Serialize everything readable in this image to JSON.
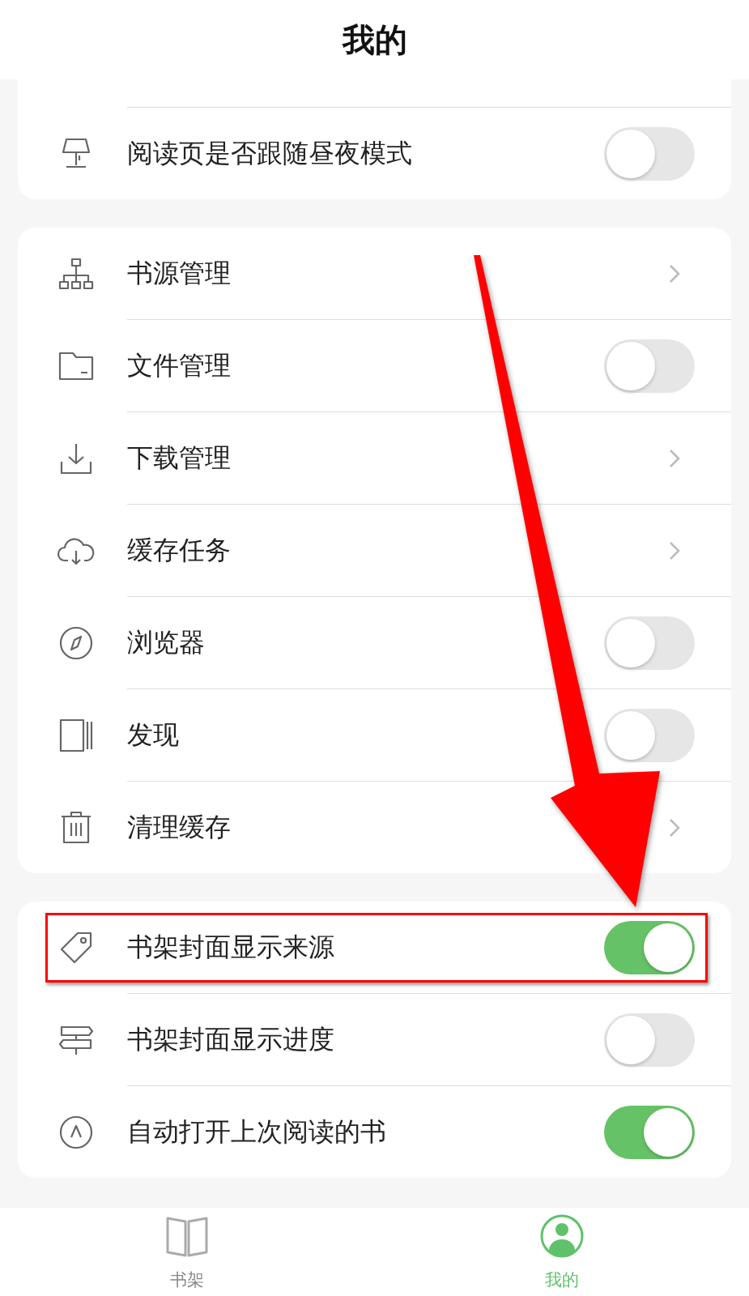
{
  "header": {
    "title": "我的"
  },
  "sections": [
    {
      "rows": [
        {
          "label": "阅读页是否跟随昼夜模式",
          "kind": "toggle",
          "on": false
        }
      ]
    },
    {
      "rows": [
        {
          "label": "书源管理",
          "kind": "link"
        },
        {
          "label": "文件管理",
          "kind": "toggle",
          "on": false
        },
        {
          "label": "下载管理",
          "kind": "link"
        },
        {
          "label": "缓存任务",
          "kind": "link"
        },
        {
          "label": "浏览器",
          "kind": "toggle",
          "on": false
        },
        {
          "label": "发现",
          "kind": "toggle",
          "on": false
        },
        {
          "label": "清理缓存",
          "kind": "link"
        }
      ]
    },
    {
      "rows": [
        {
          "label": "书架封面显示来源",
          "kind": "toggle",
          "on": true
        },
        {
          "label": "书架封面显示进度",
          "kind": "toggle",
          "on": false
        },
        {
          "label": "自动打开上次阅读的书",
          "kind": "toggle",
          "on": true
        }
      ]
    }
  ],
  "tabs": [
    {
      "label": "书架",
      "selected": false
    },
    {
      "label": "我的",
      "selected": true
    }
  ]
}
